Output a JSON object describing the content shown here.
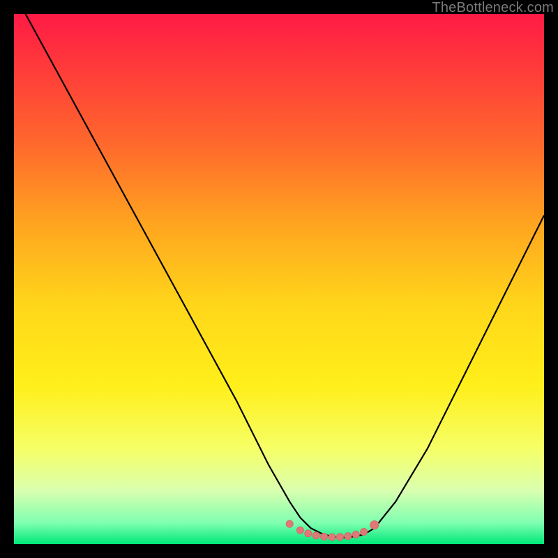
{
  "watermark": {
    "text": "TheBottleneck.com"
  },
  "colors": {
    "black": "#000000",
    "curve_stroke": "#000000",
    "marker_fill": "#e07878",
    "marker_stroke": "#d86868",
    "gradient_stops": [
      {
        "offset": 0.0,
        "color": "#ff1a45"
      },
      {
        "offset": 0.1,
        "color": "#ff3a3a"
      },
      {
        "offset": 0.25,
        "color": "#ff6a2c"
      },
      {
        "offset": 0.4,
        "color": "#ffa61f"
      },
      {
        "offset": 0.55,
        "color": "#ffd61a"
      },
      {
        "offset": 0.7,
        "color": "#ffef1a"
      },
      {
        "offset": 0.82,
        "color": "#f6ff66"
      },
      {
        "offset": 0.9,
        "color": "#d9ffb0"
      },
      {
        "offset": 0.96,
        "color": "#7fffb0"
      },
      {
        "offset": 1.0,
        "color": "#00e87a"
      }
    ]
  },
  "chart_data": {
    "type": "line",
    "title": "",
    "xlabel": "",
    "ylabel": "",
    "xlim": [
      0,
      100
    ],
    "ylim": [
      0,
      100
    ],
    "series": [
      {
        "name": "bottleneck-curve",
        "x": [
          0,
          6,
          12,
          18,
          24,
          30,
          36,
          42,
          48,
          52,
          54,
          56,
          58,
          60,
          62,
          64,
          66,
          68,
          72,
          78,
          84,
          90,
          96,
          100
        ],
        "y": [
          104,
          93,
          82,
          71,
          60,
          49,
          38,
          27,
          15,
          8,
          5,
          3,
          2,
          1.4,
          1.2,
          1.4,
          1.8,
          3,
          8,
          18,
          30,
          42,
          54,
          62
        ]
      }
    ],
    "markers": {
      "name": "optimal-range-markers",
      "x": [
        52,
        54,
        55.5,
        57,
        58.5,
        60,
        61.5,
        63,
        64.5,
        66,
        68
      ],
      "y": [
        3.8,
        2.6,
        2.0,
        1.6,
        1.4,
        1.3,
        1.35,
        1.5,
        1.8,
        2.3,
        3.6
      ],
      "r": [
        5,
        5,
        5,
        5,
        5,
        5,
        5,
        5,
        5,
        5,
        6
      ]
    }
  }
}
